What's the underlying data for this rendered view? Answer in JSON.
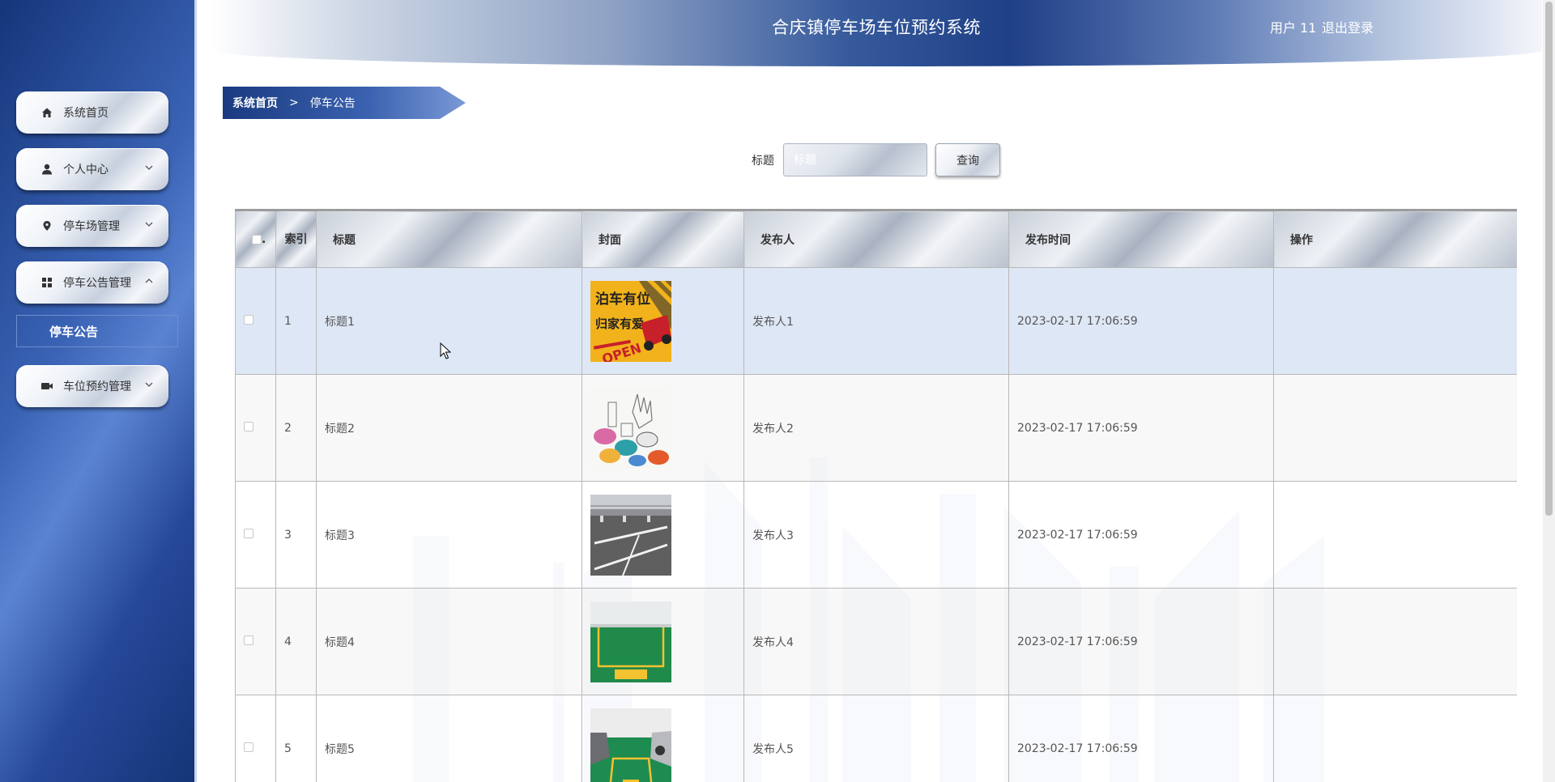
{
  "app": {
    "title": "合庆镇停车场车位预约系统"
  },
  "header": {
    "user_text": "用户 11",
    "logout_label": "退出登录"
  },
  "sidebar": {
    "items": [
      {
        "label": "系统首页",
        "icon": "home-icon",
        "expandable": false
      },
      {
        "label": "个人中心",
        "icon": "user-icon",
        "expandable": true,
        "expanded": false
      },
      {
        "label": "停车场管理",
        "icon": "location-icon",
        "expandable": true,
        "expanded": false
      },
      {
        "label": "停车公告管理",
        "icon": "grid-icon",
        "expandable": true,
        "expanded": true
      },
      {
        "label": "车位预约管理",
        "icon": "video-icon",
        "expandable": true,
        "expanded": false
      }
    ],
    "submenu": {
      "label": "停车公告"
    }
  },
  "breadcrumb": {
    "home": "系统首页",
    "separator": ">",
    "current": "停车公告"
  },
  "search": {
    "label": "标题",
    "placeholder": "标题",
    "value": "",
    "button_label": "查询"
  },
  "table": {
    "headers": {
      "select": ".",
      "index": "索引",
      "title": "标题",
      "cover": "封面",
      "publisher": "发布人",
      "time": "发布时间",
      "actions": "操作"
    },
    "rows": [
      {
        "index": "1",
        "title": "标题1",
        "cover": "cover-parking-poster",
        "publisher": "发布人1",
        "time": "2023-02-17 17:06:59",
        "highlighted": true
      },
      {
        "index": "2",
        "title": "标题2",
        "cover": "cover-cartoon-cars",
        "publisher": "发布人2",
        "time": "2023-02-17 17:06:59",
        "highlighted": false
      },
      {
        "index": "3",
        "title": "标题3",
        "cover": "cover-outdoor-lot",
        "publisher": "发布人3",
        "time": "2023-02-17 17:06:59",
        "highlighted": false
      },
      {
        "index": "4",
        "title": "标题4",
        "cover": "cover-green-space",
        "publisher": "发布人4",
        "time": "2023-02-17 17:06:59",
        "highlighted": false
      },
      {
        "index": "5",
        "title": "标题5",
        "cover": "cover-garage-cars",
        "publisher": "发布人5",
        "time": "2023-02-17 17:06:59",
        "highlighted": false
      }
    ]
  }
}
